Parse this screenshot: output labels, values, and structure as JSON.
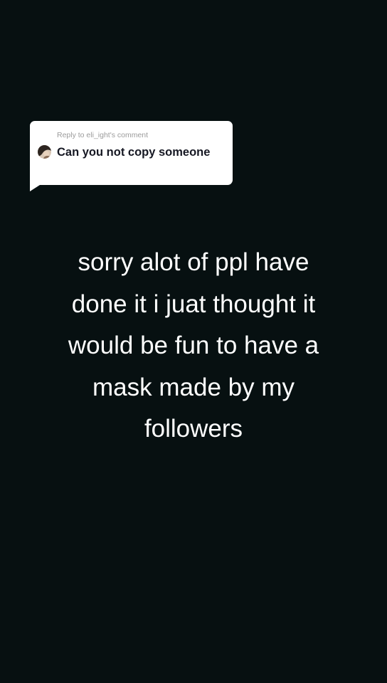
{
  "reply": {
    "header": "Reply to eli_ight's comment",
    "avatar_icon": "user-avatar-icon",
    "comment": "Can you not copy someone"
  },
  "caption": {
    "text": "sorry alot of ppl have\ndone it i juat thought it\nwould be fun to have a\nmask made by my\nfollowers"
  },
  "colors": {
    "background": "#071011",
    "bubble": "#ffffff",
    "caption_text": "#ffffff",
    "comment_text": "#161823",
    "header_text": "#9b9b9b"
  }
}
